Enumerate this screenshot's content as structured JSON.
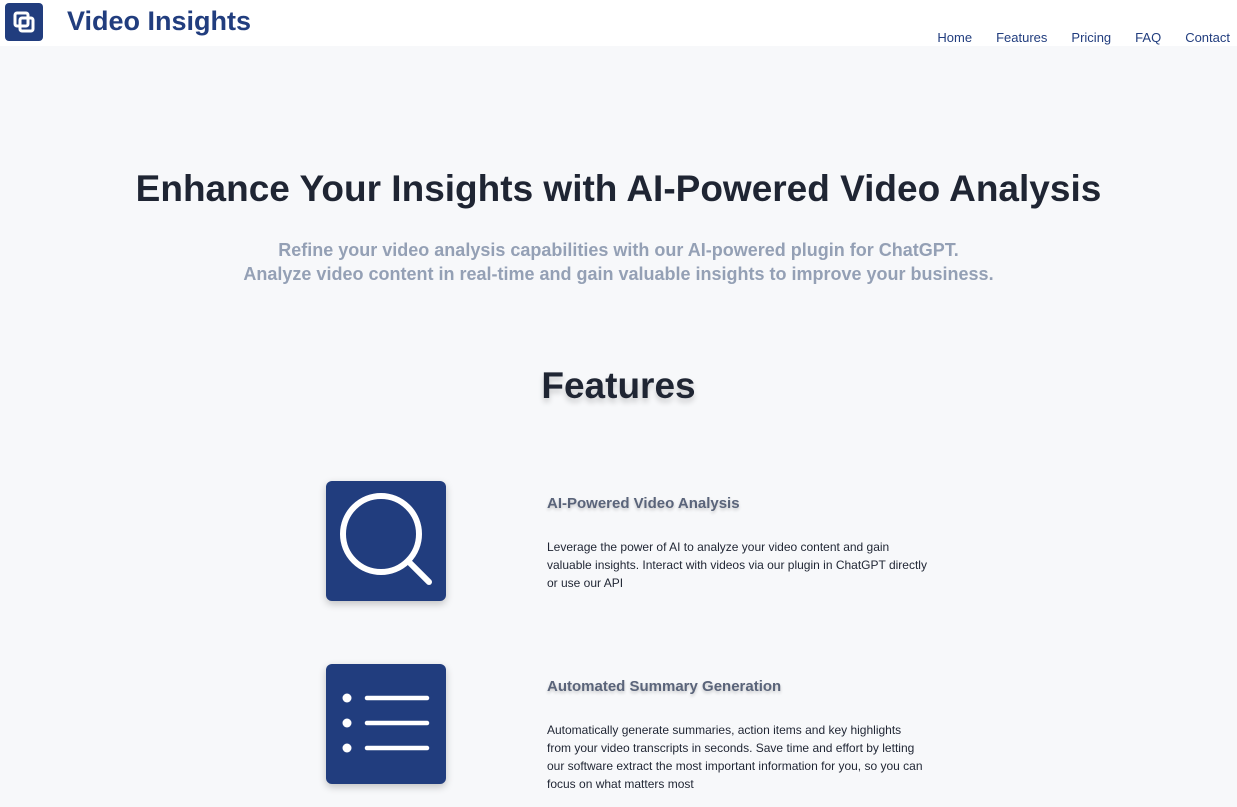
{
  "header": {
    "logo_icon": "logo-square-icon",
    "brand": "Video Insights",
    "nav": [
      "Home",
      "Features",
      "Pricing",
      "FAQ",
      "Contact"
    ]
  },
  "hero": {
    "title": "Enhance Your Insights with AI-Powered Video Analysis",
    "subtitle_line1": "Refine your video analysis capabilities with our AI-powered plugin for ChatGPT.",
    "subtitle_line2": "Analyze video content in real-time and gain valuable insights to improve your business."
  },
  "features": {
    "title": "Features",
    "items": [
      {
        "icon": "search-icon",
        "title": "AI-Powered Video Analysis",
        "description": "Leverage the power of AI to analyze your video content and gain valuable insights. Interact with videos via our plugin in ChatGPT directly or use our API"
      },
      {
        "icon": "list-icon",
        "title": "Automated Summary Generation",
        "description": "Automatically generate summaries, action items and key highlights from your video transcripts in seconds. Save time and effort by letting our software extract the most important information for you, so you can focus on what matters most"
      }
    ]
  },
  "colors": {
    "brand": "#213d7e",
    "background": "#f7f8fa",
    "subtitle": "#94a0b5"
  }
}
